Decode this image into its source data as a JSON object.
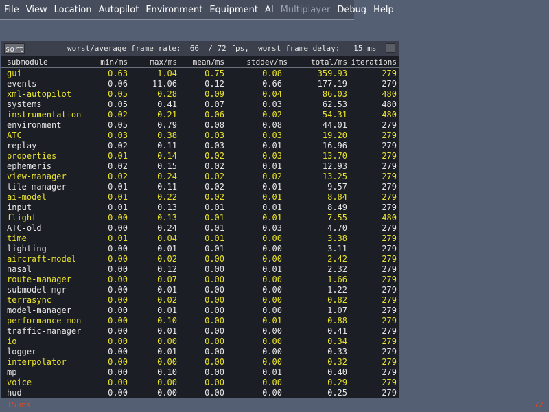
{
  "menu": {
    "items": [
      {
        "label": "File",
        "enabled": true
      },
      {
        "label": "View",
        "enabled": true
      },
      {
        "label": "Location",
        "enabled": true
      },
      {
        "label": "Autopilot",
        "enabled": true
      },
      {
        "label": "Environment",
        "enabled": true
      },
      {
        "label": "Equipment",
        "enabled": true
      },
      {
        "label": "AI",
        "enabled": true
      },
      {
        "label": "Multiplayer",
        "enabled": false
      },
      {
        "label": "Debug",
        "enabled": true
      },
      {
        "label": "Help",
        "enabled": true
      }
    ]
  },
  "monitor": {
    "sort_label": "sort",
    "stats_text": "worst/average frame rate:  66  / 72 fps,  worst frame delay:   15 ms",
    "columns": {
      "name": "submodule",
      "min": "min/ms",
      "max": "max/ms",
      "mean": "mean/ms",
      "stddev": "stddev/ms",
      "total": "total/ms",
      "iterations": "iterations"
    },
    "rows": [
      {
        "name": "gui",
        "min": "0.63",
        "max": "1.04",
        "mean": "0.75",
        "stddev": "0.08",
        "total": "359.93",
        "iterations": "279",
        "highlight": true
      },
      {
        "name": "events",
        "min": "0.06",
        "max": "11.06",
        "mean": "0.12",
        "stddev": "0.66",
        "total": "177.19",
        "iterations": "279",
        "highlight": false
      },
      {
        "name": "xml-autopilot",
        "min": "0.05",
        "max": "0.28",
        "mean": "0.09",
        "stddev": "0.04",
        "total": "86.03",
        "iterations": "480",
        "highlight": true
      },
      {
        "name": "systems",
        "min": "0.05",
        "max": "0.41",
        "mean": "0.07",
        "stddev": "0.03",
        "total": "62.53",
        "iterations": "480",
        "highlight": false
      },
      {
        "name": "instrumentation",
        "min": "0.02",
        "max": "0.21",
        "mean": "0.06",
        "stddev": "0.02",
        "total": "54.31",
        "iterations": "480",
        "highlight": true
      },
      {
        "name": "environment",
        "min": "0.05",
        "max": "0.79",
        "mean": "0.08",
        "stddev": "0.08",
        "total": "44.01",
        "iterations": "279",
        "highlight": false
      },
      {
        "name": "ATC",
        "min": "0.03",
        "max": "0.38",
        "mean": "0.03",
        "stddev": "0.03",
        "total": "19.20",
        "iterations": "279",
        "highlight": true
      },
      {
        "name": "replay",
        "min": "0.02",
        "max": "0.11",
        "mean": "0.03",
        "stddev": "0.01",
        "total": "16.96",
        "iterations": "279",
        "highlight": false
      },
      {
        "name": "properties",
        "min": "0.01",
        "max": "0.14",
        "mean": "0.02",
        "stddev": "0.03",
        "total": "13.70",
        "iterations": "279",
        "highlight": true
      },
      {
        "name": "ephemeris",
        "min": "0.02",
        "max": "0.15",
        "mean": "0.02",
        "stddev": "0.01",
        "total": "12.93",
        "iterations": "279",
        "highlight": false
      },
      {
        "name": "view-manager",
        "min": "0.02",
        "max": "0.24",
        "mean": "0.02",
        "stddev": "0.02",
        "total": "13.25",
        "iterations": "279",
        "highlight": true
      },
      {
        "name": "tile-manager",
        "min": "0.01",
        "max": "0.11",
        "mean": "0.02",
        "stddev": "0.01",
        "total": "9.57",
        "iterations": "279",
        "highlight": false
      },
      {
        "name": "ai-model",
        "min": "0.01",
        "max": "0.22",
        "mean": "0.02",
        "stddev": "0.01",
        "total": "8.84",
        "iterations": "279",
        "highlight": true
      },
      {
        "name": "input",
        "min": "0.01",
        "max": "0.13",
        "mean": "0.01",
        "stddev": "0.01",
        "total": "8.49",
        "iterations": "279",
        "highlight": false
      },
      {
        "name": "flight",
        "min": "0.00",
        "max": "0.13",
        "mean": "0.01",
        "stddev": "0.01",
        "total": "7.55",
        "iterations": "480",
        "highlight": true
      },
      {
        "name": "ATC-old",
        "min": "0.00",
        "max": "0.24",
        "mean": "0.01",
        "stddev": "0.03",
        "total": "4.70",
        "iterations": "279",
        "highlight": false
      },
      {
        "name": "time",
        "min": "0.01",
        "max": "0.04",
        "mean": "0.01",
        "stddev": "0.00",
        "total": "3.38",
        "iterations": "279",
        "highlight": true
      },
      {
        "name": "lighting",
        "min": "0.00",
        "max": "0.01",
        "mean": "0.01",
        "stddev": "0.00",
        "total": "3.11",
        "iterations": "279",
        "highlight": false
      },
      {
        "name": "aircraft-model",
        "min": "0.00",
        "max": "0.02",
        "mean": "0.00",
        "stddev": "0.00",
        "total": "2.42",
        "iterations": "279",
        "highlight": true
      },
      {
        "name": "nasal",
        "min": "0.00",
        "max": "0.12",
        "mean": "0.00",
        "stddev": "0.01",
        "total": "2.32",
        "iterations": "279",
        "highlight": false
      },
      {
        "name": "route-manager",
        "min": "0.00",
        "max": "0.07",
        "mean": "0.00",
        "stddev": "0.00",
        "total": "1.66",
        "iterations": "279",
        "highlight": true
      },
      {
        "name": "submodel-mgr",
        "min": "0.00",
        "max": "0.01",
        "mean": "0.00",
        "stddev": "0.00",
        "total": "1.22",
        "iterations": "279",
        "highlight": false
      },
      {
        "name": "terrasync",
        "min": "0.00",
        "max": "0.02",
        "mean": "0.00",
        "stddev": "0.00",
        "total": "0.82",
        "iterations": "279",
        "highlight": true
      },
      {
        "name": "model-manager",
        "min": "0.00",
        "max": "0.01",
        "mean": "0.00",
        "stddev": "0.00",
        "total": "1.07",
        "iterations": "279",
        "highlight": false
      },
      {
        "name": "performance-mon",
        "min": "0.00",
        "max": "0.10",
        "mean": "0.00",
        "stddev": "0.01",
        "total": "0.88",
        "iterations": "279",
        "highlight": true
      },
      {
        "name": "traffic-manager",
        "min": "0.00",
        "max": "0.01",
        "mean": "0.00",
        "stddev": "0.00",
        "total": "0.41",
        "iterations": "279",
        "highlight": false
      },
      {
        "name": "io",
        "min": "0.00",
        "max": "0.00",
        "mean": "0.00",
        "stddev": "0.00",
        "total": "0.34",
        "iterations": "279",
        "highlight": true
      },
      {
        "name": "logger",
        "min": "0.00",
        "max": "0.01",
        "mean": "0.00",
        "stddev": "0.00",
        "total": "0.33",
        "iterations": "279",
        "highlight": false
      },
      {
        "name": "interpolator",
        "min": "0.00",
        "max": "0.00",
        "mean": "0.00",
        "stddev": "0.00",
        "total": "0.32",
        "iterations": "279",
        "highlight": true
      },
      {
        "name": "mp",
        "min": "0.00",
        "max": "0.10",
        "mean": "0.00",
        "stddev": "0.01",
        "total": "0.40",
        "iterations": "279",
        "highlight": false
      },
      {
        "name": "voice",
        "min": "0.00",
        "max": "0.00",
        "mean": "0.00",
        "stddev": "0.00",
        "total": "0.29",
        "iterations": "279",
        "highlight": true
      },
      {
        "name": "hud",
        "min": "0.00",
        "max": "0.00",
        "mean": "0.00",
        "stddev": "0.00",
        "total": "0.25",
        "iterations": "279",
        "highlight": false
      }
    ]
  },
  "footer": {
    "frame_delay": "15 ms",
    "fps": "72"
  },
  "colors": {
    "background": "#545f74",
    "highlight_text": "#e8e22c",
    "normal_text": "#e6e6e6",
    "footer_text": "#e04a20"
  }
}
